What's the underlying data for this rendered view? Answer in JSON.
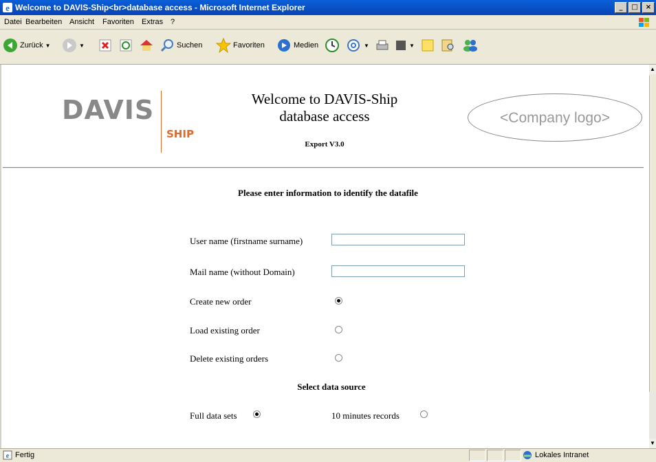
{
  "window": {
    "title": "Welcome to DAVIS-Ship<br>database access - Microsoft Internet Explorer",
    "min_label": "_",
    "max_label": "□",
    "close_label": "×"
  },
  "menu": [
    "Datei",
    "Bearbeiten",
    "Ansicht",
    "Favoriten",
    "Extras",
    "?"
  ],
  "toolbar": {
    "back": "Zurück",
    "search": "Suchen",
    "favorites": "Favoriten",
    "media": "Medien"
  },
  "page": {
    "logo_main": "DAVIS",
    "logo_sub": "SHIP",
    "title_line1": "Welcome to DAVIS-Ship",
    "title_line2": "database access",
    "version": "Export V3.0",
    "company_logo": "<Company logo>",
    "prompt": "Please enter information to identify the datafile",
    "user_label": "User name (firstname surname)",
    "user_value": "",
    "mail_label": "Mail name (without Domain)",
    "mail_value": "",
    "order_options": [
      {
        "label": "Create new order",
        "checked": true
      },
      {
        "label": "Load existing order",
        "checked": false
      },
      {
        "label": "Delete existing orders",
        "checked": false
      }
    ],
    "section_title": "Select data source",
    "source_options": [
      {
        "label": "Full data sets",
        "checked": true
      },
      {
        "label": "10 minutes records",
        "checked": false
      }
    ]
  },
  "status": {
    "text": "Fertig",
    "zone": "Lokales Intranet"
  }
}
